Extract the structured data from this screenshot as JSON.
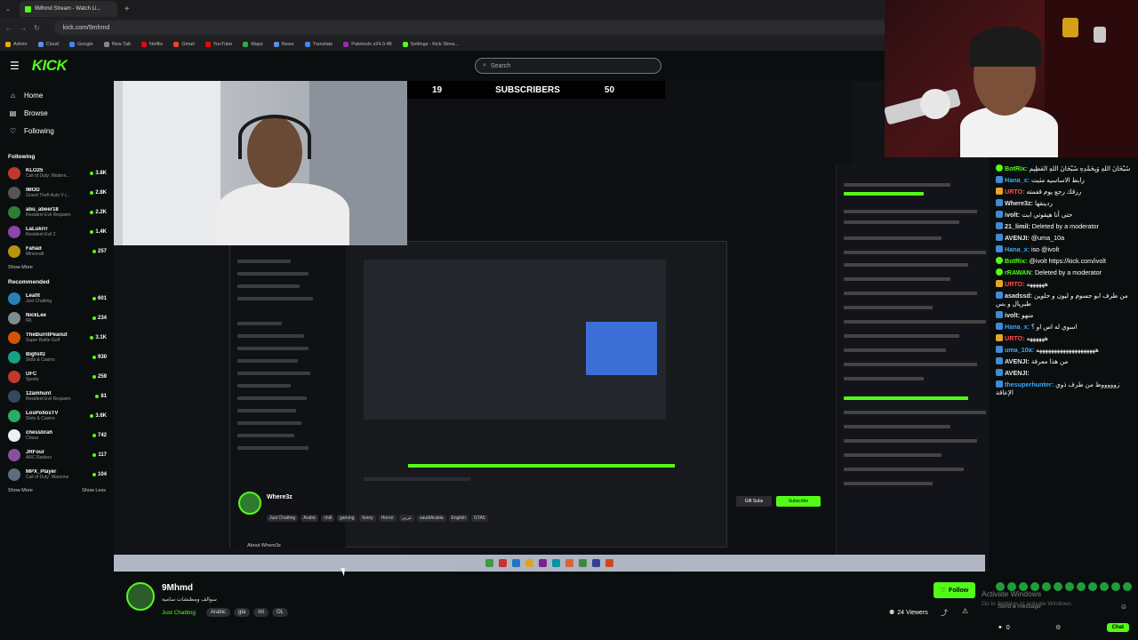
{
  "browser": {
    "tab_title": "9Mhmd Stream - Watch Li...",
    "new_tab": "+",
    "url": "kick.com/9mhmd",
    "bookmarks": [
      "Admin",
      "Cloud",
      "Google",
      "New Tab",
      "Netflix",
      "Gmail",
      "YouTube",
      "Maps",
      "News",
      "Translate",
      "Paletools v24.0.48",
      "Settings - Kick Strea..."
    ]
  },
  "header": {
    "logo": "KICK",
    "search_placeholder": "Search"
  },
  "sidebar": {
    "nav": [
      {
        "label": "Home",
        "icon": "home-icon"
      },
      {
        "label": "Browse",
        "icon": "browse-icon"
      },
      {
        "label": "Following",
        "icon": "heart-icon"
      }
    ],
    "following_title": "Following",
    "following": [
      {
        "name": "KLO25",
        "category": "Call of Duty: Modern...",
        "viewers": "3.8K",
        "color": "#c0392b"
      },
      {
        "name": "IMOD",
        "category": "Grand Theft Auto V (...",
        "viewers": "2.8K",
        "color": "#555"
      },
      {
        "name": "abu_abeer18",
        "category": "Resident Evil Requiem",
        "viewers": "2.2K",
        "color": "#2e7d32"
      },
      {
        "name": "LaLukrrr",
        "category": "Resident Evil 2",
        "viewers": "1.4K",
        "color": "#8e44ad"
      },
      {
        "name": "Fahad",
        "category": "Minecraft",
        "viewers": "257",
        "color": "#b7950b"
      }
    ],
    "show_more": "Show More",
    "recommended_title": "Recommended",
    "recommended": [
      {
        "name": "Leafit",
        "category": "Just Chatting",
        "viewers": "601",
        "color": "#2980b9"
      },
      {
        "name": "NickLee",
        "category": "IRL",
        "viewers": "234",
        "color": "#7f8c8d"
      },
      {
        "name": "TheBurntPeanut",
        "category": "Super Battle Golf",
        "viewers": "3.1K",
        "color": "#d35400"
      },
      {
        "name": "Bigfoltz",
        "category": "Slots & Casino",
        "viewers": "930",
        "color": "#16a085"
      },
      {
        "name": "UFC",
        "category": "Sports",
        "viewers": "259",
        "color": "#c0392b"
      },
      {
        "name": "12amhunt",
        "category": "Resident Evil Requiem",
        "viewers": "81",
        "color": "#34495e"
      },
      {
        "name": "LosPollosTV",
        "category": "Slots & Casino",
        "viewers": "3.6K",
        "color": "#27ae60"
      },
      {
        "name": "chessbrah",
        "category": "Chess",
        "viewers": "742",
        "color": "#ecf0f1"
      },
      {
        "name": "JRFour",
        "category": "ARC Raiders",
        "viewers": "117",
        "color": "#884ea0"
      },
      {
        "name": "MPX_Player",
        "category": "Call of Duty: Warzone",
        "viewers": "104",
        "color": "#5d6d7e"
      }
    ],
    "show_more2": "Show More",
    "show_less": "Show Less"
  },
  "stream_overlay": {
    "sub_left": "19",
    "sub_label": "SUBSCRIBERS",
    "sub_right": "50"
  },
  "nested": {
    "channel": "Where3z",
    "tags": [
      "Just Chatting",
      "Arabic",
      "chill",
      "gaming",
      "funny",
      "Horror",
      "عربي",
      "saudiArabia",
      "English",
      "GTA5"
    ],
    "gift": "Gift Subs",
    "subscribe": "Subscribe",
    "about": "About Where3z"
  },
  "channel": {
    "name": "9Mhmd",
    "title": "سوالف ومطنشات سامية",
    "category": "Just Chatting",
    "tags": [
      "Arabic",
      "gta",
      "mt",
      "OL"
    ],
    "follow": "Follow",
    "viewers": "24 Viewers"
  },
  "chat": {
    "messages": [
      {
        "user": "BotRix:",
        "text": "سُبْحَانَ اللهِ وَبِحَمْدِهِ سُبْحَانَ اللهِ العَظِيم",
        "color": "#53fc18"
      },
      {
        "user": "Hana_x:",
        "text": "رابط الاساسيه مثبت",
        "color": "#3fa9f5"
      },
      {
        "user": "URTO:",
        "text": "رزقك رجع يوم ققمته",
        "color": "#ff4d4d"
      },
      {
        "user": "Where3z:",
        "text": "ردينقها",
        "color": "#e6e6e6"
      },
      {
        "user": "ivolt:",
        "text": "حتى أنا هيقوتي ابت",
        "color": "#e6e6e6"
      },
      {
        "user": "21_limil:",
        "text": "Deleted by a moderator",
        "color": "#e6e6e6"
      },
      {
        "user": "AVENJI:",
        "text": "@uma_10a",
        "color": "#e6e6e6"
      },
      {
        "user": "Hana_x:",
        "text": "iso @ivolt",
        "color": "#3fa9f5"
      },
      {
        "user": "BotRix:",
        "text": "@ivolt https://kick.com/ivolt",
        "color": "#53fc18"
      },
      {
        "user": "rRAWAN:",
        "text": "Deleted by a moderator",
        "color": "#53fc18"
      },
      {
        "user": "URTO:",
        "text": "ههههههه",
        "color": "#ff4d4d"
      },
      {
        "user": "asadssd:",
        "text": "من طرف ابو جسوم و ليون و حلوين طبريال و بس",
        "color": "#e6e6e6"
      },
      {
        "user": "ivolt:",
        "text": "منهو",
        "color": "#e6e6e6"
      },
      {
        "user": "Hana_x:",
        "text": "اسوي له اس او ؟",
        "color": "#3fa9f5"
      },
      {
        "user": "URTO:",
        "text": "ههههههه",
        "color": "#ff4d4d"
      },
      {
        "user": "uma_10a:",
        "text": "ههههههههههههههههههههه",
        "color": "#3fa9f5"
      },
      {
        "user": "AVENJI:",
        "text": "من هذا معرفة",
        "color": "#e6e6e6"
      },
      {
        "user": "AVENJI:",
        "text": "",
        "color": "#e6e6e6"
      },
      {
        "user": "thesuperhunter:",
        "text": "زوووووط من طرف ذوي الإعاقة",
        "color": "#3fa9f5"
      }
    ],
    "input_placeholder": "Send a message",
    "chat_button": "Chat",
    "count": "0"
  },
  "watermark": {
    "line1": "Activate Windows",
    "line2": "Go to Settings to activate Windows."
  }
}
